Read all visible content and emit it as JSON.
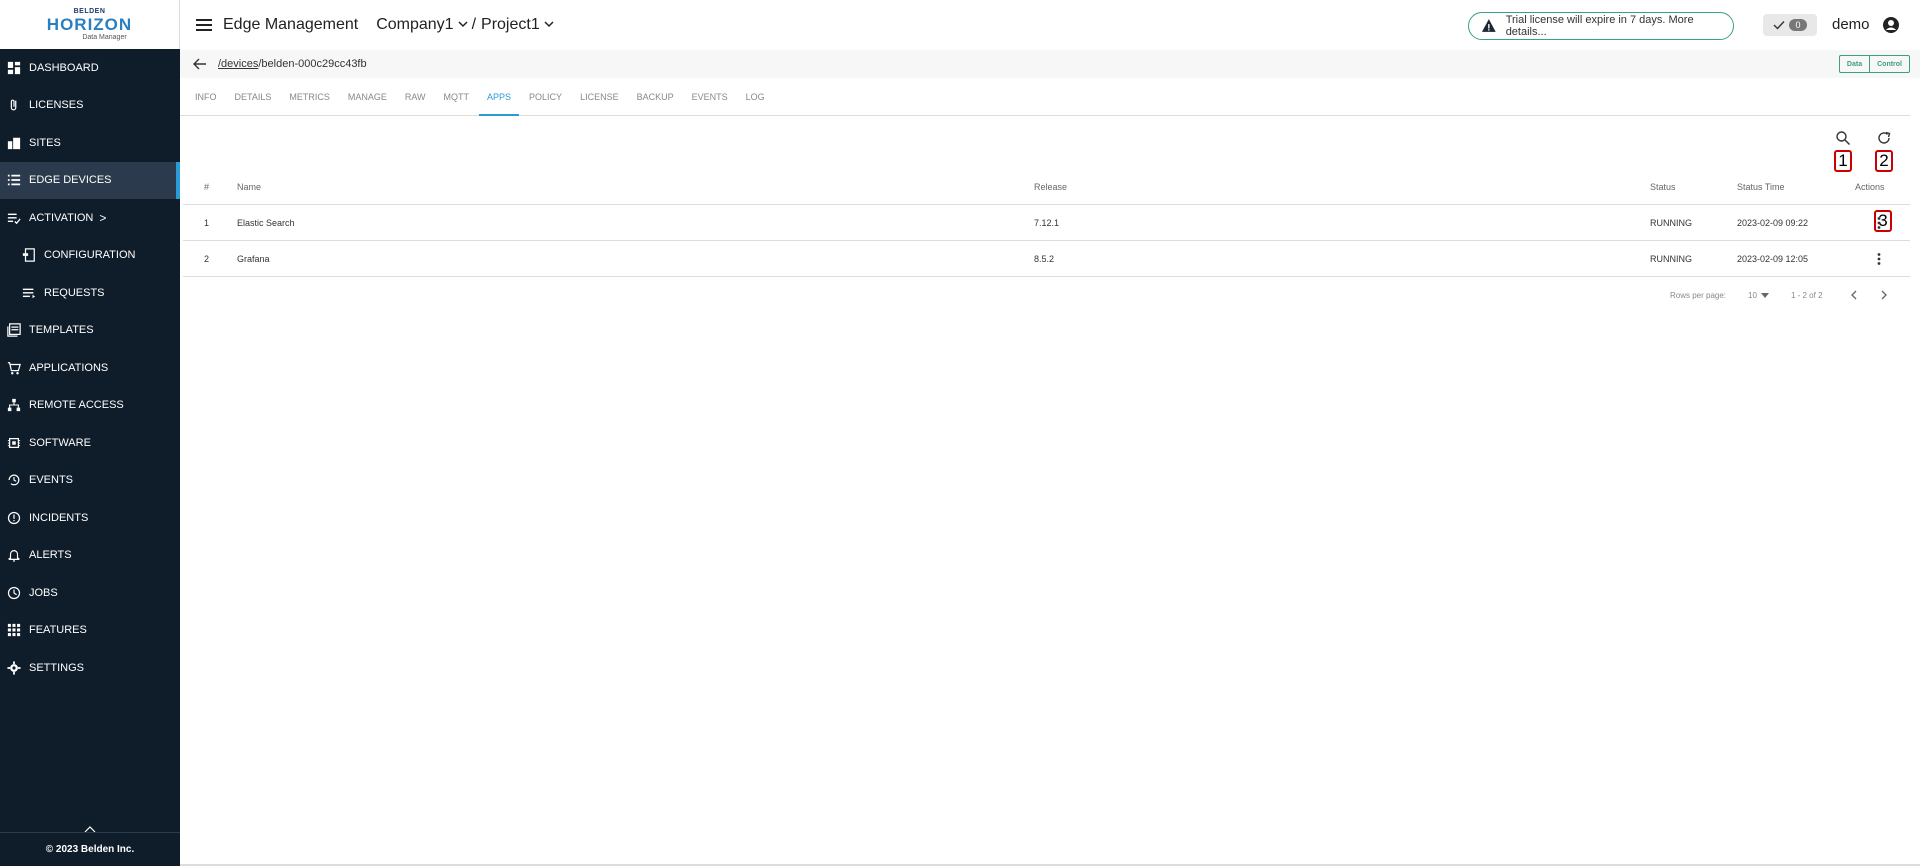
{
  "brand": {
    "top": "BELDEN",
    "main": "HORIZON",
    "sub": "Data Manager"
  },
  "sidebar": {
    "items": [
      {
        "label": "DASHBOARD",
        "icon": "dashboard-icon"
      },
      {
        "label": "LICENSES",
        "icon": "paperclip-icon"
      },
      {
        "label": "SITES",
        "icon": "building-icon"
      },
      {
        "label": "EDGE DEVICES",
        "icon": "list-icon",
        "active": true
      },
      {
        "label": "ACTIVATION",
        "icon": "playlist-check-icon",
        "chevron": ">"
      },
      {
        "label": "CONFIGURATION",
        "icon": "config-icon"
      },
      {
        "label": "REQUESTS",
        "icon": "requests-icon"
      },
      {
        "label": "TEMPLATES",
        "icon": "templates-icon"
      },
      {
        "label": "APPLICATIONS",
        "icon": "cart-icon"
      },
      {
        "label": "REMOTE ACCESS",
        "icon": "network-icon"
      },
      {
        "label": "SOFTWARE",
        "icon": "chip-icon"
      },
      {
        "label": "EVENTS",
        "icon": "history-icon"
      },
      {
        "label": "INCIDENTS",
        "icon": "alert-circle-icon"
      },
      {
        "label": "ALERTS",
        "icon": "bell-icon"
      },
      {
        "label": "JOBS",
        "icon": "clock-icon"
      },
      {
        "label": "FEATURES",
        "icon": "grid-icon"
      },
      {
        "label": "SETTINGS",
        "icon": "gear-icon"
      }
    ],
    "footer": "© 2023 Belden Inc."
  },
  "header": {
    "title": "Edge Management",
    "company": "Company1",
    "separator": "/",
    "project": "Project1",
    "trial_text": "Trial license will expire in 7 days. More details...",
    "notif_count": "0",
    "user": "demo"
  },
  "path": {
    "link": "/devices",
    "rest": "/belden-000c29cc43fb"
  },
  "mode": {
    "data": "Data",
    "control": "Control"
  },
  "tabs": [
    "INFO",
    "DETAILS",
    "METRICS",
    "MANAGE",
    "RAW",
    "MQTT",
    "APPS",
    "POLICY",
    "LICENSE",
    "BACKUP",
    "EVENTS",
    "LOG"
  ],
  "active_tab": "APPS",
  "markers": {
    "search": "1",
    "refresh": "2",
    "actions": "3"
  },
  "table": {
    "columns": {
      "idx": "#",
      "name": "Name",
      "release": "Release",
      "status": "Status",
      "time": "Status Time",
      "actions": "Actions"
    },
    "rows": [
      {
        "idx": "1",
        "name": "Elastic Search",
        "release": "7.12.1",
        "status": "RUNNING",
        "time": "2023-02-09 09:22"
      },
      {
        "idx": "2",
        "name": "Grafana",
        "release": "8.5.2",
        "status": "RUNNING",
        "time": "2023-02-09 12:05"
      }
    ]
  },
  "pager": {
    "rows_label": "Rows per page:",
    "rows_value": "10",
    "range": "1 - 2 of 2"
  },
  "colors": {
    "sidebar_bg": "#0f1c2a",
    "accent": "#2b9bd8",
    "green": "#3aa17e"
  }
}
